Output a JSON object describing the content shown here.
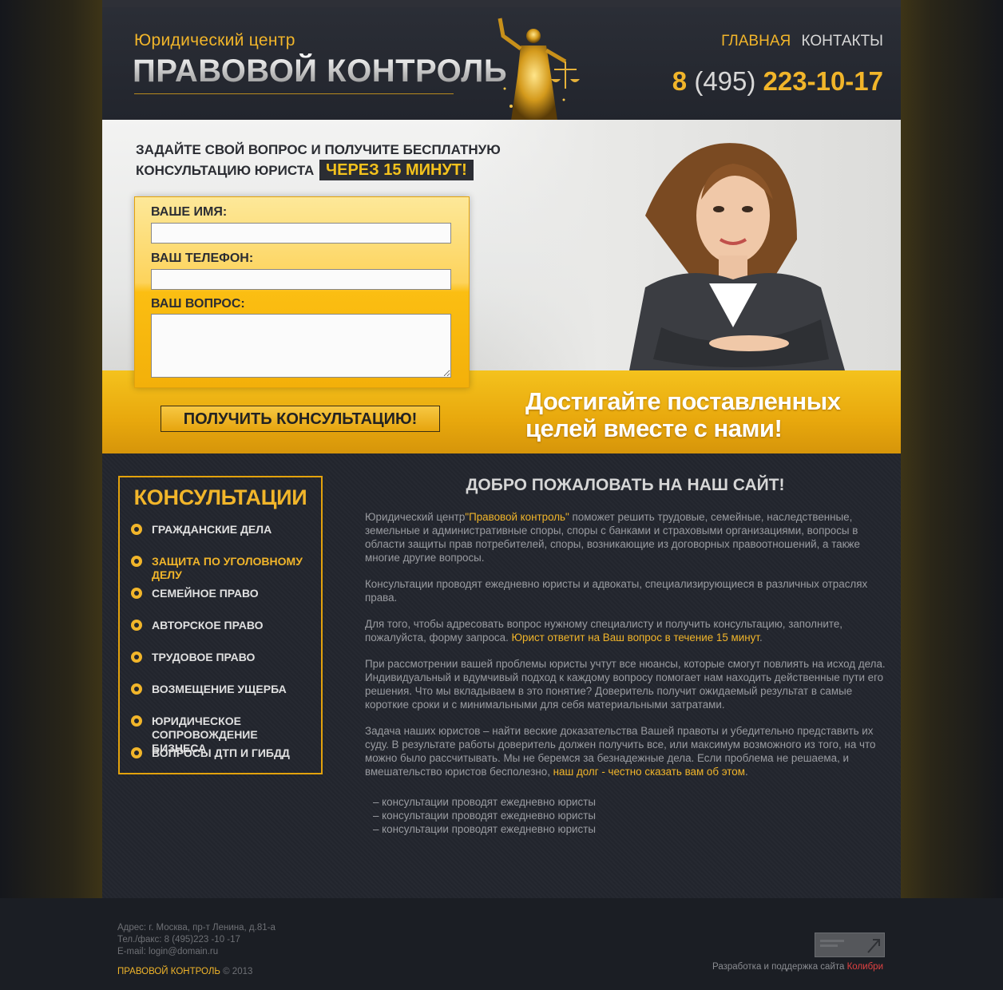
{
  "header": {
    "logo_subtitle": "Юридический центр",
    "logo_title": "ПРАВОВОЙ КОНТРОЛЬ",
    "nav": [
      {
        "label": "ГЛАВНАЯ"
      },
      {
        "label": "КОНТАКТЫ"
      }
    ],
    "phone": {
      "prefix": "8",
      "code": "(495)",
      "number": "223-10-17"
    }
  },
  "hero": {
    "headline_line1": "ЗАДАЙТЕ СВОЙ ВОПРОС И ПОЛУЧИТЕ БЕСПЛАТНУЮ",
    "headline_line2": "КОНСУЛЬТАЦИЮ ЮРИСТА",
    "headline_tag": "ЧЕРЕЗ 15 МИНУТ!",
    "form": {
      "name_label": "ВАШЕ ИМЯ:",
      "phone_label": "ВАШ ТЕЛЕФОН:",
      "question_label": "ВАШ ВОПРОС:",
      "name_value": "",
      "phone_value": "",
      "question_value": "",
      "submit_label": "ПОЛУЧИТЬ КОНСУЛЬТАЦИЮ!"
    },
    "slogan_line1": "Достигайте поставленных",
    "slogan_line2": "целей вместе с нами!"
  },
  "sidebar": {
    "title": "КОНСУЛЬТАЦИИ",
    "items": [
      {
        "label": "ГРАЖДАНСКИЕ ДЕЛА",
        "active": false
      },
      {
        "label": "ЗАЩИТА ПО УГОЛОВНОМУ ДЕЛУ",
        "active": true
      },
      {
        "label": "СЕМЕЙНОЕ ПРАВО",
        "active": false
      },
      {
        "label": "АВТОРСКОЕ ПРАВО",
        "active": false
      },
      {
        "label": "ТРУДОВОЕ ПРАВО",
        "active": false
      },
      {
        "label": "ВОЗМЕЩЕНИЕ УЩЕРБА",
        "active": false
      },
      {
        "label": "ЮРИДИЧЕСКОЕ СОПРОВОЖДЕНИЕ БИЗНЕСА",
        "active": false
      },
      {
        "label": "ВОПРОСЫ ДТП И ГИБДД",
        "active": false
      }
    ]
  },
  "main": {
    "title": "ДОБРО ПОЖАЛОВАТЬ НА НАШ САЙТ!",
    "p1_a": "Юридический центр",
    "p1_hl": "\"Правовой контроль\"",
    "p1_b": " поможет решить трудовые, семейные, наследственные, земельные и административные споры, споры с банками и страховыми организациями, вопросы в области защиты прав потребителей, споры, возникающие из договорных правоотношений, а также многие другие вопросы.",
    "p2": "Консультации проводят ежедневно юристы и адвокаты, специализирующиеся в различных отраслях права.",
    "p3_a": "Для того, чтобы адресовать вопрос нужному специалисту и получить консультацию, заполните, пожалуйста, форму запроса. ",
    "p3_hl": "Юрист ответит на Ваш вопрос в течение 15 минут",
    "p3_b": ".",
    "p4": "При рассмотрении вашей проблемы юристы учтут все нюансы, которые смогут повлиять на исход дела. Индивидуальный и вдумчивый подход к каждому вопросу помогает нам находить действенные пути его решения. Что мы вкладываем в это понятие? Доверитель получит ожидаемый результат в самые короткие сроки и с минимальными для себя материальными затратами.",
    "p5_a": "Задача наших юристов – найти веские доказательства Вашей правоты и убедительно представить их суду. В результате работы доверитель должен получить все, или максимум возможного из того, на что можно было рассчитывать. Мы не беремся за безнадежные дела. Если проблема не решаема, и вмешательство юристов бесполезно, ",
    "p5_hl": "наш долг - честно сказать вам об этом",
    "p5_b": ".",
    "bullets": [
      "– консультации проводят ежедневно юристы",
      "– консультации проводят ежедневно юристы",
      "– консультации проводят ежедневно юристы"
    ]
  },
  "footer": {
    "address": "Адрес: г. Москва, пр-т Ленина, д.81-а",
    "phone": "Тел./факс: 8 (495)223 -10 -17",
    "email_label": "E-mail: ",
    "email": "login@domain.ru",
    "brand": "ПРАВОВОЙ КОНТРОЛЬ",
    "copyright": " © 2013",
    "dev_text": "Разработка и поддержка сайта ",
    "dev_link": "Колибри"
  },
  "colors": {
    "accent": "#f1b52a",
    "background": "#23262e",
    "hero_yellow": "#f4c21d",
    "link_red": "#e04242"
  }
}
